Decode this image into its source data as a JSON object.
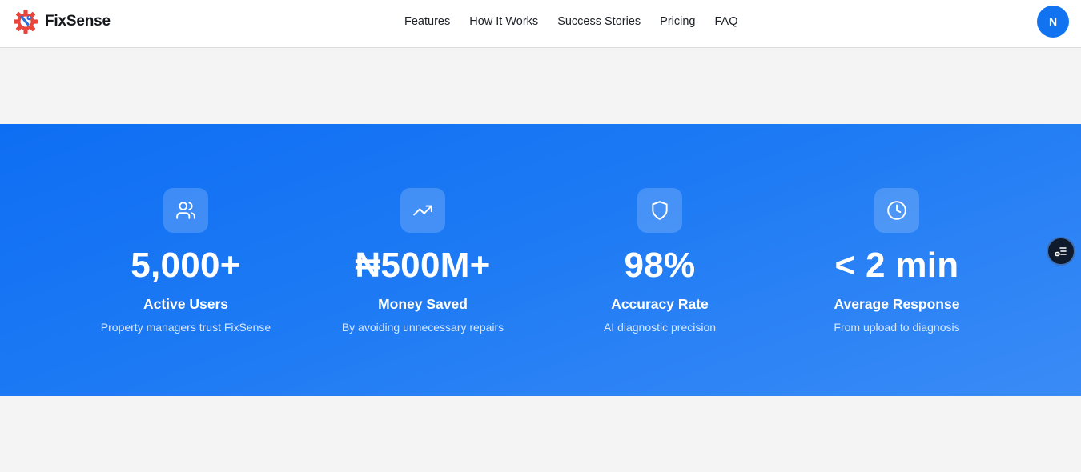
{
  "brand": {
    "name": "FixSense",
    "logo_icon": "gear-wrench-icon"
  },
  "nav": {
    "links": [
      {
        "label": "Features"
      },
      {
        "label": "How It Works"
      },
      {
        "label": "Success Stories"
      },
      {
        "label": "Pricing"
      },
      {
        "label": "FAQ"
      }
    ]
  },
  "user": {
    "avatar_initial": "N"
  },
  "stats": {
    "items": [
      {
        "icon": "users-icon",
        "value": "5,000+",
        "label": "Active Users",
        "description": "Property managers trust FixSense"
      },
      {
        "icon": "trending-up-icon",
        "value": "₦500M+",
        "label": "Money Saved",
        "description": "By avoiding unnecessary repairs"
      },
      {
        "icon": "shield-icon",
        "value": "98%",
        "label": "Accuracy Rate",
        "description": "AI diagnostic precision"
      },
      {
        "icon": "clock-icon",
        "value": "< 2 min",
        "label": "Average Response",
        "description": "From upload to diagnosis"
      }
    ]
  },
  "floating_widget": {
    "icon": "settings-toggle-icon"
  },
  "colors": {
    "accent": "#1173ef",
    "stats_gradient_start": "#0e6ef3",
    "stats_gradient_end": "#3a8bf6",
    "page_background": "#f4f4f5",
    "logo_primary": "#e8453c",
    "logo_secondary": "#2f6fd8"
  }
}
